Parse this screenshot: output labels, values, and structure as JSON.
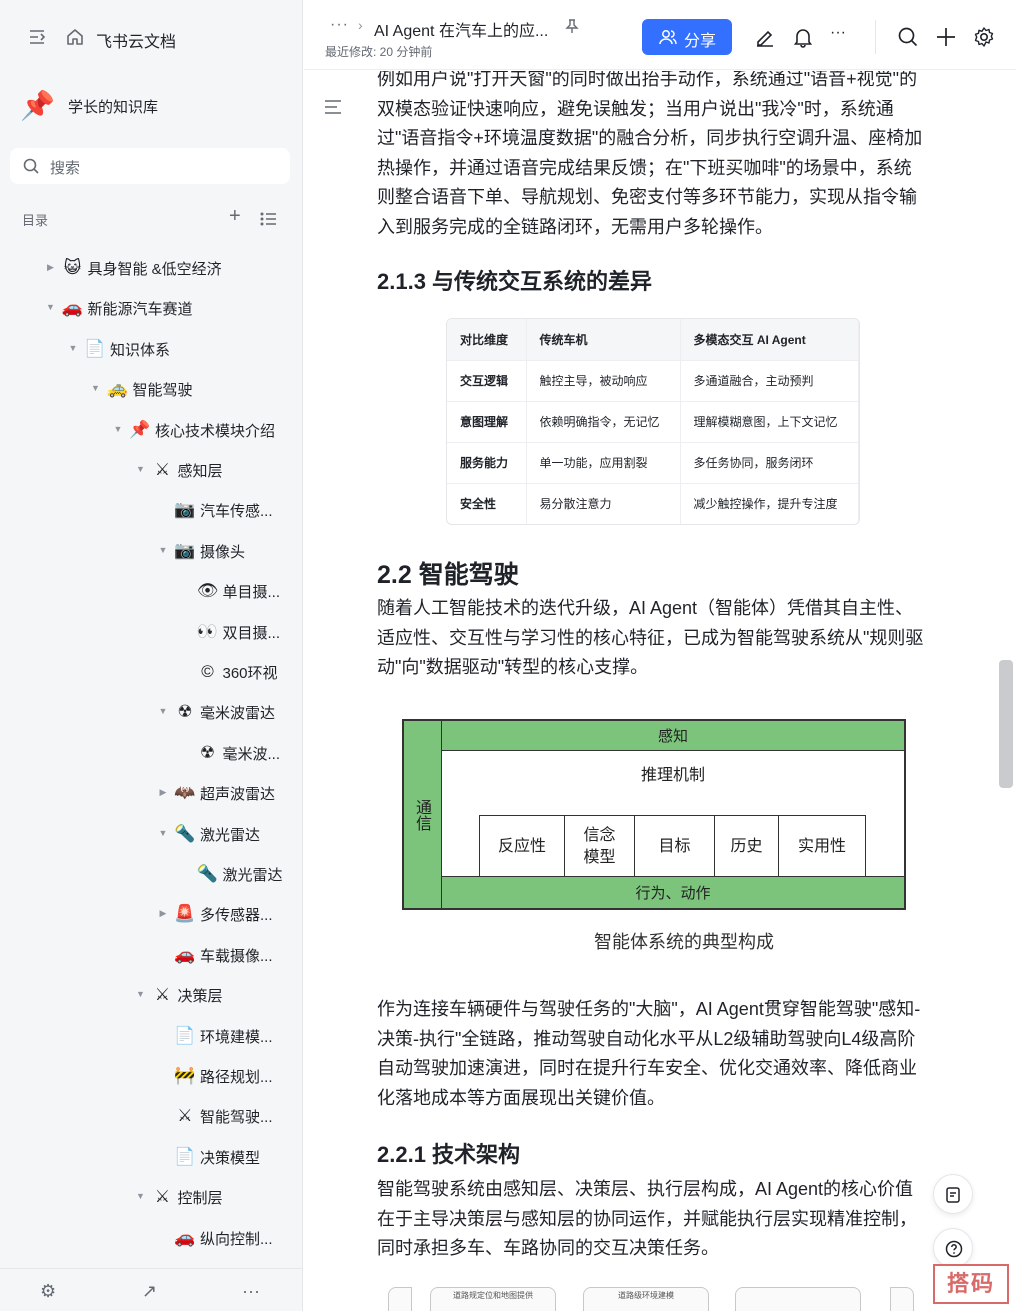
{
  "app": {
    "title": "飞书云文档"
  },
  "space": {
    "name": "学长的知识库"
  },
  "search": {
    "placeholder": "搜索"
  },
  "toc": {
    "label": "目录"
  },
  "tree": [
    {
      "label": "具身智能 &低空经济",
      "icon": "😺",
      "arrow": "▶"
    },
    {
      "label": "新能源汽车赛道",
      "icon": "🚗",
      "arrow": "▼"
    },
    {
      "label": "知识体系",
      "icon": "📄",
      "arrow": "▼"
    },
    {
      "label": "智能驾驶",
      "icon": "🚕",
      "arrow": "▼"
    },
    {
      "label": "核心技术模块介绍",
      "icon": "📌",
      "arrow": "▼"
    },
    {
      "label": "感知层",
      "icon": "⚔",
      "arrow": "▼"
    },
    {
      "label": "汽车传感...",
      "icon": "📷",
      "arrow": ""
    },
    {
      "label": "摄像头",
      "icon": "📷",
      "arrow": "▼"
    },
    {
      "label": "单目摄...",
      "icon": "👁",
      "arrow": ""
    },
    {
      "label": "双目摄...",
      "icon": "👀",
      "arrow": ""
    },
    {
      "label": "360环视",
      "icon": "©",
      "arrow": ""
    },
    {
      "label": "毫米波雷达",
      "icon": "☢",
      "arrow": "▼"
    },
    {
      "label": "毫米波...",
      "icon": "☢",
      "arrow": ""
    },
    {
      "label": "超声波雷达",
      "icon": "🦇",
      "arrow": "▶"
    },
    {
      "label": "激光雷达",
      "icon": "🔦",
      "arrow": "▼"
    },
    {
      "label": "激光雷达",
      "icon": "🔦",
      "arrow": ""
    },
    {
      "label": "多传感器...",
      "icon": "🚨",
      "arrow": "▶"
    },
    {
      "label": "车载摄像...",
      "icon": "🚗",
      "arrow": ""
    },
    {
      "label": "决策层",
      "icon": "⚔",
      "arrow": "▼"
    },
    {
      "label": "环境建模...",
      "icon": "📄",
      "arrow": ""
    },
    {
      "label": "路径规划...",
      "icon": "🚧",
      "arrow": ""
    },
    {
      "label": "智能驾驶...",
      "icon": "⚔",
      "arrow": ""
    },
    {
      "label": "决策模型",
      "icon": "📄",
      "arrow": ""
    },
    {
      "label": "控制层",
      "icon": "⚔",
      "arrow": "▼"
    },
    {
      "label": "纵向控制...",
      "icon": "🚗",
      "arrow": ""
    }
  ],
  "header": {
    "more": "···",
    "doc_title": "AI Agent 在汽车上的应...",
    "modified": "最近修改: 20 分钟前",
    "share_label": "分享"
  },
  "doc": {
    "para1": "例如用户说\"打开天窗\"的同时做出抬手动作，系统通过\"语音+视觉\"的双模态验证快速响应，避免误触发；当用户说出\"我冷\"时，系统通过\"语音指令+环境温度数据\"的融合分析，同步执行空调升温、座椅加热操作，并通过语音完成结果反馈；在\"下班买咖啡\"的场景中，系统则整合语音下单、导航规划、免密支付等多环节能力，实现从指令输入到服务完成的全链路闭环，无需用户多轮操作。",
    "h_213": "2.1.3 与传统交互系统的差异",
    "table": {
      "headers": [
        "对比维度",
        "传统车机",
        "多模态交互 AI Agent"
      ],
      "rows": [
        [
          "交互逻辑",
          "触控主导，被动响应",
          "多通道融合，主动预判"
        ],
        [
          "意图理解",
          "依赖明确指令，无记忆",
          "理解模糊意图，上下文记忆"
        ],
        [
          "服务能力",
          "单一功能，应用割裂",
          "多任务协同，服务闭环"
        ],
        [
          "安全性",
          "易分散注意力",
          "减少触控操作，提升专注度"
        ]
      ]
    },
    "h_22": "2.2 智能驾驶",
    "para2": "随着人工智能技术的迭代升级，AI Agent（智能体）凭借其自主性、适应性、交互性与学习性的核心特征，已成为智能驾驶系统从\"规则驱动\"向\"数据驱动\"转型的核心支撑。",
    "diagram": {
      "perceive": "感知",
      "reasoning": "推理机制",
      "communication": "通信",
      "boxes": [
        "反应性",
        "信念\n模型",
        "目标",
        "历史",
        "实用性"
      ],
      "action": "行为、动作",
      "caption": "智能体系统的典型构成"
    },
    "para3": "作为连接车辆硬件与驾驶任务的\"大脑\"，AI Agent贯穿智能驾驶\"感知-决策-执行\"全链路，推动驾驶自动化水平从L2级辅助驾驶向L4级高阶自动驾驶加速演进，同时在提升行车安全、优化交通效率、降低商业化落地成本等方面展现出关键价值。",
    "h_221": "2.2.1 技术架构",
    "para4": "智能驾驶系统由感知层、决策层、执行层构成，AI Agent的核心价值在于主导决策层与感知层的协同运作，并赋能执行层实现精准控制，同时承担多车、车路协同的交互决策任务。",
    "arch_cards": [
      "道路规定位和地图提供",
      "道路级环境建模",
      ""
    ]
  },
  "watermark": "搭码"
}
